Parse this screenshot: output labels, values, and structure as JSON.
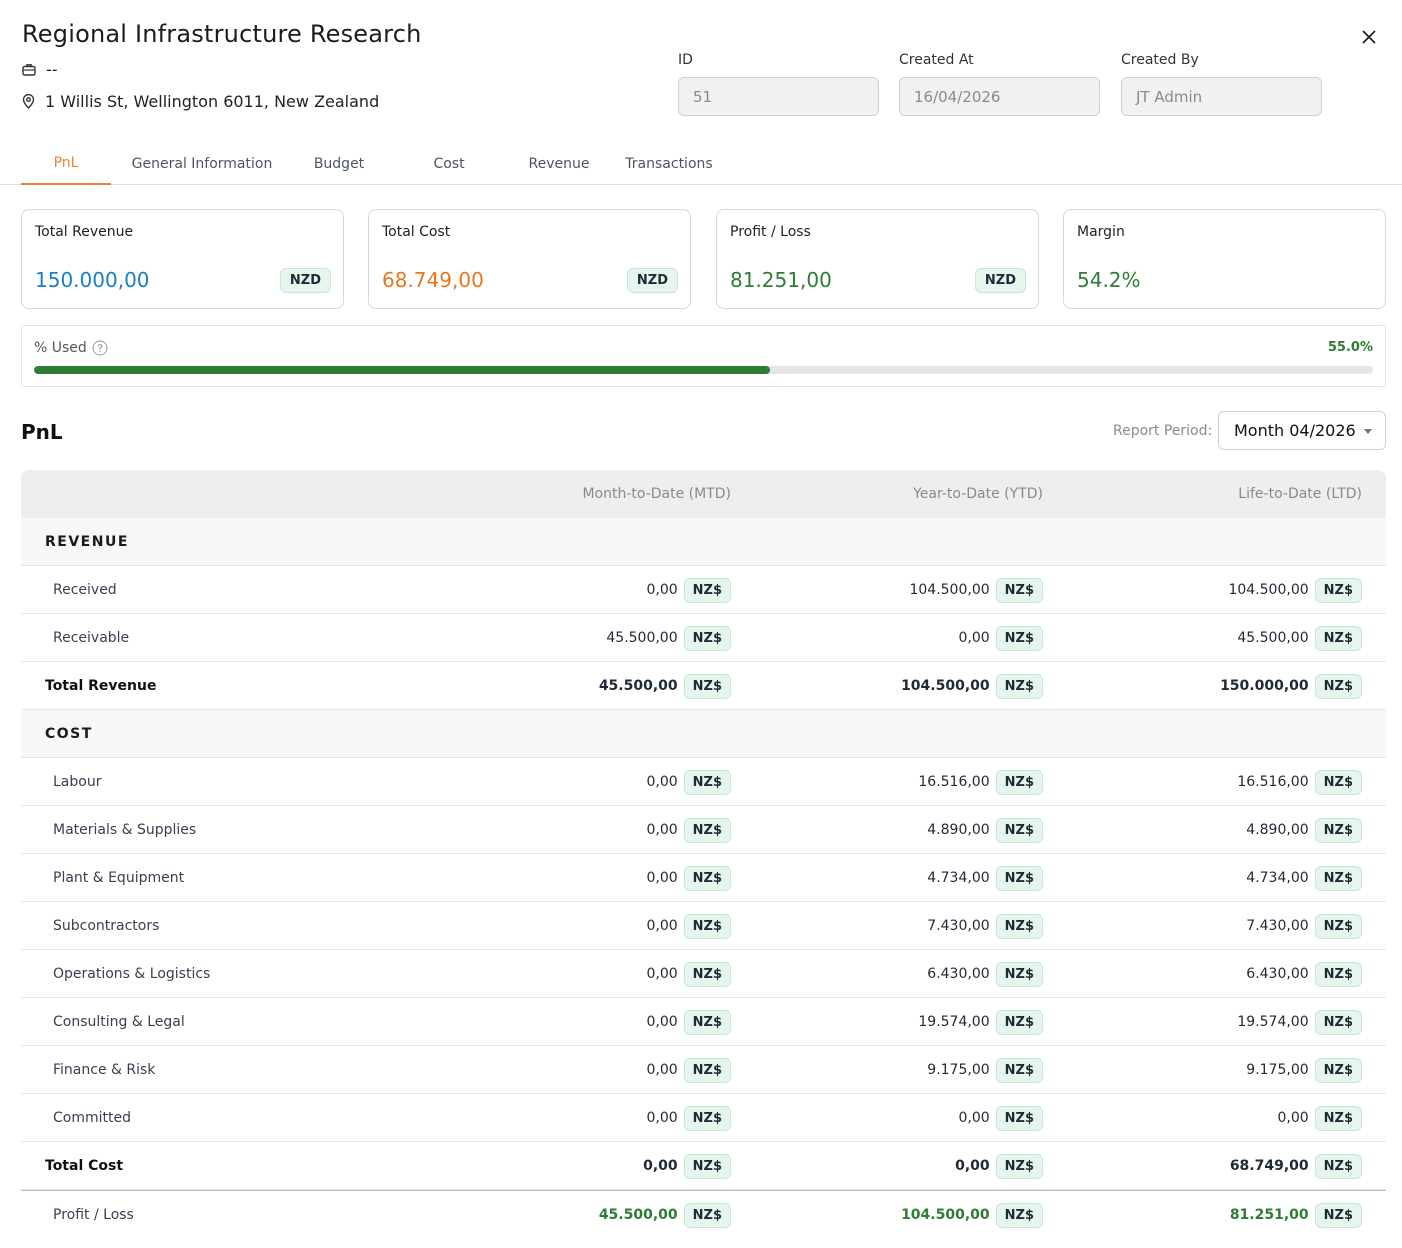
{
  "header": {
    "title": "Regional Infrastructure Research",
    "client": "--",
    "address": "1 Willis St, Wellington 6011, New Zealand",
    "fields": [
      {
        "label": "ID",
        "value": "51"
      },
      {
        "label": "Created At",
        "value": "16/04/2026"
      },
      {
        "label": "Created By",
        "value": "JT Admin"
      }
    ]
  },
  "tabs": [
    "PnL",
    "General Information",
    "Budget",
    "Cost",
    "Revenue",
    "Transactions"
  ],
  "active_tab": "PnL",
  "summary_cards": [
    {
      "label": "Total Revenue",
      "value": "150.000,00",
      "currency": "NZD",
      "color": "#1a7fc1"
    },
    {
      "label": "Total Cost",
      "value": "68.749,00",
      "currency": "NZD",
      "color": "#e8771e"
    },
    {
      "label": "Profit / Loss",
      "value": "81.251,00",
      "currency": "NZD",
      "color": "#2e7d32"
    },
    {
      "label": "Margin",
      "value": "54.2%",
      "currency": "",
      "color": "#2e7d32"
    }
  ],
  "usage": {
    "label": "% Used",
    "percent_text": "55.0%",
    "percent": 55.0
  },
  "pnl": {
    "title": "PnL",
    "period_label": "Report Period:",
    "period_value": "Month 04/2026",
    "columns": [
      "Month-to-Date (MTD)",
      "Year-to-Date (YTD)",
      "Life-to-Date (LTD)"
    ],
    "currency": "NZ$",
    "rows": [
      {
        "type": "section",
        "label": "REVENUE"
      },
      {
        "type": "item",
        "label": "Received",
        "mtd": "0,00",
        "ytd": "104.500,00",
        "ltd": "104.500,00"
      },
      {
        "type": "item",
        "label": "Receivable",
        "mtd": "45.500,00",
        "ytd": "0,00",
        "ltd": "45.500,00"
      },
      {
        "type": "total",
        "label": "Total Revenue",
        "mtd": "45.500,00",
        "ytd": "104.500,00",
        "ltd": "150.000,00"
      },
      {
        "type": "section",
        "label": "COST"
      },
      {
        "type": "item",
        "label": "Labour",
        "mtd": "0,00",
        "ytd": "16.516,00",
        "ltd": "16.516,00"
      },
      {
        "type": "item",
        "label": "Materials & Supplies",
        "mtd": "0,00",
        "ytd": "4.890,00",
        "ltd": "4.890,00"
      },
      {
        "type": "item",
        "label": "Plant & Equipment",
        "mtd": "0,00",
        "ytd": "4.734,00",
        "ltd": "4.734,00"
      },
      {
        "type": "item",
        "label": "Subcontractors",
        "mtd": "0,00",
        "ytd": "7.430,00",
        "ltd": "7.430,00"
      },
      {
        "type": "item",
        "label": "Operations & Logistics",
        "mtd": "0,00",
        "ytd": "6.430,00",
        "ltd": "6.430,00"
      },
      {
        "type": "item",
        "label": "Consulting & Legal",
        "mtd": "0,00",
        "ytd": "19.574,00",
        "ltd": "19.574,00"
      },
      {
        "type": "item",
        "label": "Finance & Risk",
        "mtd": "0,00",
        "ytd": "9.175,00",
        "ltd": "9.175,00"
      },
      {
        "type": "item",
        "label": "Committed",
        "mtd": "0,00",
        "ytd": "0,00",
        "ltd": "0,00"
      },
      {
        "type": "total",
        "label": "Total Cost",
        "mtd": "0,00",
        "ytd": "0,00",
        "ltd": "68.749,00"
      },
      {
        "type": "pl",
        "label": "Profit / Loss",
        "mtd": "45.500,00",
        "ytd": "104.500,00",
        "ltd": "81.251,00"
      }
    ]
  },
  "icons": {
    "briefcase": "briefcase-icon",
    "location": "map-pin-icon",
    "close": "close-icon",
    "help": "help-circle-icon",
    "dropdown": "chevron-down-icon"
  }
}
